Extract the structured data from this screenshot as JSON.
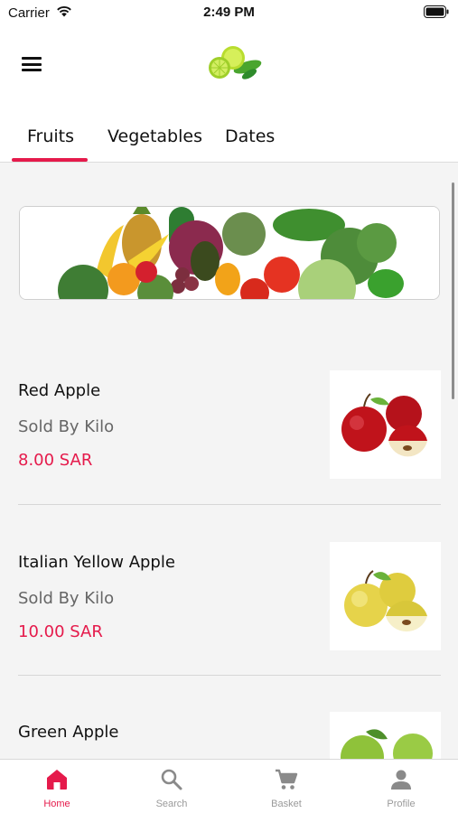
{
  "status_bar": {
    "carrier": "Carrier",
    "time": "2:49 PM"
  },
  "header": {
    "menu_icon": "hamburger-menu-icon",
    "logo_icon": "lime-leaf-logo"
  },
  "tabs": [
    {
      "label": "Fruits",
      "active": true
    },
    {
      "label": "Vegetables",
      "active": false
    },
    {
      "label": "Dates",
      "active": false
    }
  ],
  "banner": {
    "image": "mixed-vegetables-banner"
  },
  "products": [
    {
      "name": "Red Apple",
      "unit": "Sold By Kilo",
      "price": "8.00 SAR",
      "image": "red-apples"
    },
    {
      "name": "Italian Yellow Apple",
      "unit": "Sold By Kilo",
      "price": "10.00 SAR",
      "image": "yellow-apples"
    },
    {
      "name": "Green Apple",
      "unit": "",
      "price": "",
      "image": "green-apples"
    }
  ],
  "bottom_nav": [
    {
      "label": "Home",
      "icon": "home-icon",
      "active": true
    },
    {
      "label": "Search",
      "icon": "search-icon",
      "active": false
    },
    {
      "label": "Basket",
      "icon": "cart-icon",
      "active": false
    },
    {
      "label": "Profile",
      "icon": "person-icon",
      "active": false
    }
  ],
  "colors": {
    "accent": "#e51a4b",
    "background": "#f4f4f4",
    "muted_text": "#666666"
  }
}
